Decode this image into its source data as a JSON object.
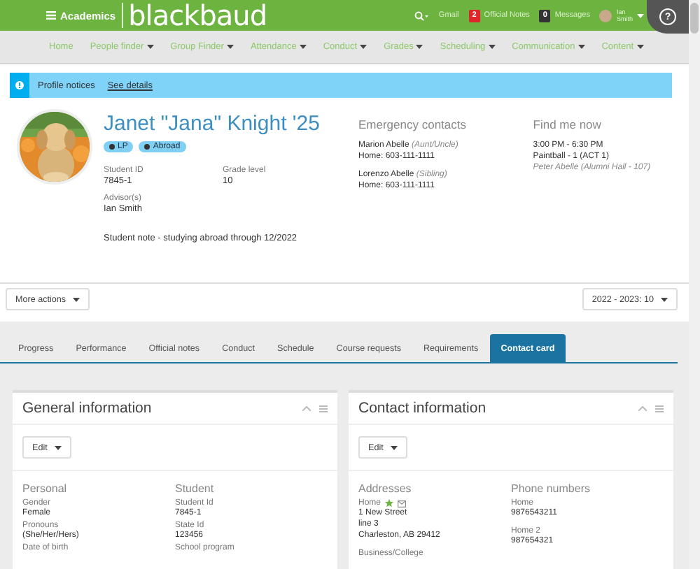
{
  "topbar": {
    "menu_label": "Academics",
    "logo": "blackbaud",
    "links": [
      "Gmail"
    ],
    "official_notes": {
      "count": "2",
      "label": "Official Notes"
    },
    "messages": {
      "count": "0",
      "label": "Messages"
    },
    "user": {
      "first": "Ian",
      "last": "Smith"
    },
    "help": "?"
  },
  "nav": [
    {
      "label": "Home",
      "has_menu": false
    },
    {
      "label": "People finder",
      "has_menu": true
    },
    {
      "label": "Group Finder",
      "has_menu": true
    },
    {
      "label": "Attendance",
      "has_menu": true
    },
    {
      "label": "Conduct",
      "has_menu": true
    },
    {
      "label": "Grades",
      "has_menu": true
    },
    {
      "label": "Scheduling",
      "has_menu": true
    },
    {
      "label": "Communication",
      "has_menu": true
    },
    {
      "label": "Content",
      "has_menu": true
    }
  ],
  "notice": {
    "title": "Profile notices",
    "link": "See details"
  },
  "profile": {
    "name": "Janet \"Jana\" Knight '25",
    "badges": [
      "LP",
      "Abroad"
    ],
    "fields": [
      {
        "label": "Student ID",
        "value": "7845-1"
      },
      {
        "label": "Grade level",
        "value": "10"
      },
      {
        "label": "Advisor(s)",
        "value": "Ian Smith"
      }
    ],
    "note": "Student note - studying abroad through 12/2022",
    "emergency": {
      "title": "Emergency contacts",
      "contacts": [
        {
          "name": "Marion Abelle",
          "relation": "(Aunt/Uncle)",
          "phone": "Home: 603-111-1111"
        },
        {
          "name": "Lorenzo Abelle",
          "relation": "(Sibling)",
          "phone": "Home: 603-111-1111"
        }
      ]
    },
    "find_me": {
      "title": "Find me now",
      "time": "3:00 PM - 6:30 PM",
      "activity": "Paintball - 1 (ACT 1)",
      "location": "Peter Abelle (Alumni Hall - 107)"
    }
  },
  "actions": {
    "more": "More actions",
    "term": "2022 - 2023: 10"
  },
  "tabs": [
    {
      "label": "Progress",
      "selected": false
    },
    {
      "label": "Performance",
      "selected": false
    },
    {
      "label": "Official notes",
      "selected": false
    },
    {
      "label": "Conduct",
      "selected": false
    },
    {
      "label": "Schedule",
      "selected": false
    },
    {
      "label": "Course requests",
      "selected": false
    },
    {
      "label": "Requirements",
      "selected": false
    },
    {
      "label": "Contact card",
      "selected": true
    }
  ],
  "general": {
    "title": "General information",
    "edit": "Edit",
    "sections": [
      {
        "title": "Personal",
        "fields": [
          {
            "label": "Gender",
            "value": "Female"
          },
          {
            "label": "Pronouns",
            "value": "(She/Her/Hers)"
          },
          {
            "label": "Date of birth"
          }
        ]
      },
      {
        "title": "Student",
        "fields": [
          {
            "label": "Student Id",
            "value": "7845-1"
          },
          {
            "label": "State Id",
            "value": "123456"
          },
          {
            "label": "School program"
          }
        ]
      }
    ]
  },
  "contact": {
    "title": "Contact information",
    "edit": "Edit",
    "addresses": {
      "title": "Addresses",
      "items": [
        {
          "label": "Home",
          "starred": true,
          "mail": true,
          "lines": [
            "1 New Street",
            "line 3",
            "Charleston, AB 29412"
          ]
        },
        {
          "label": "Business/College",
          "starred": false,
          "mail": false
        }
      ]
    },
    "phones": {
      "title": "Phone numbers",
      "items": [
        {
          "label": "Home",
          "value": "9876543211"
        },
        {
          "label": "Home 2",
          "value": "987654321"
        }
      ]
    }
  }
}
